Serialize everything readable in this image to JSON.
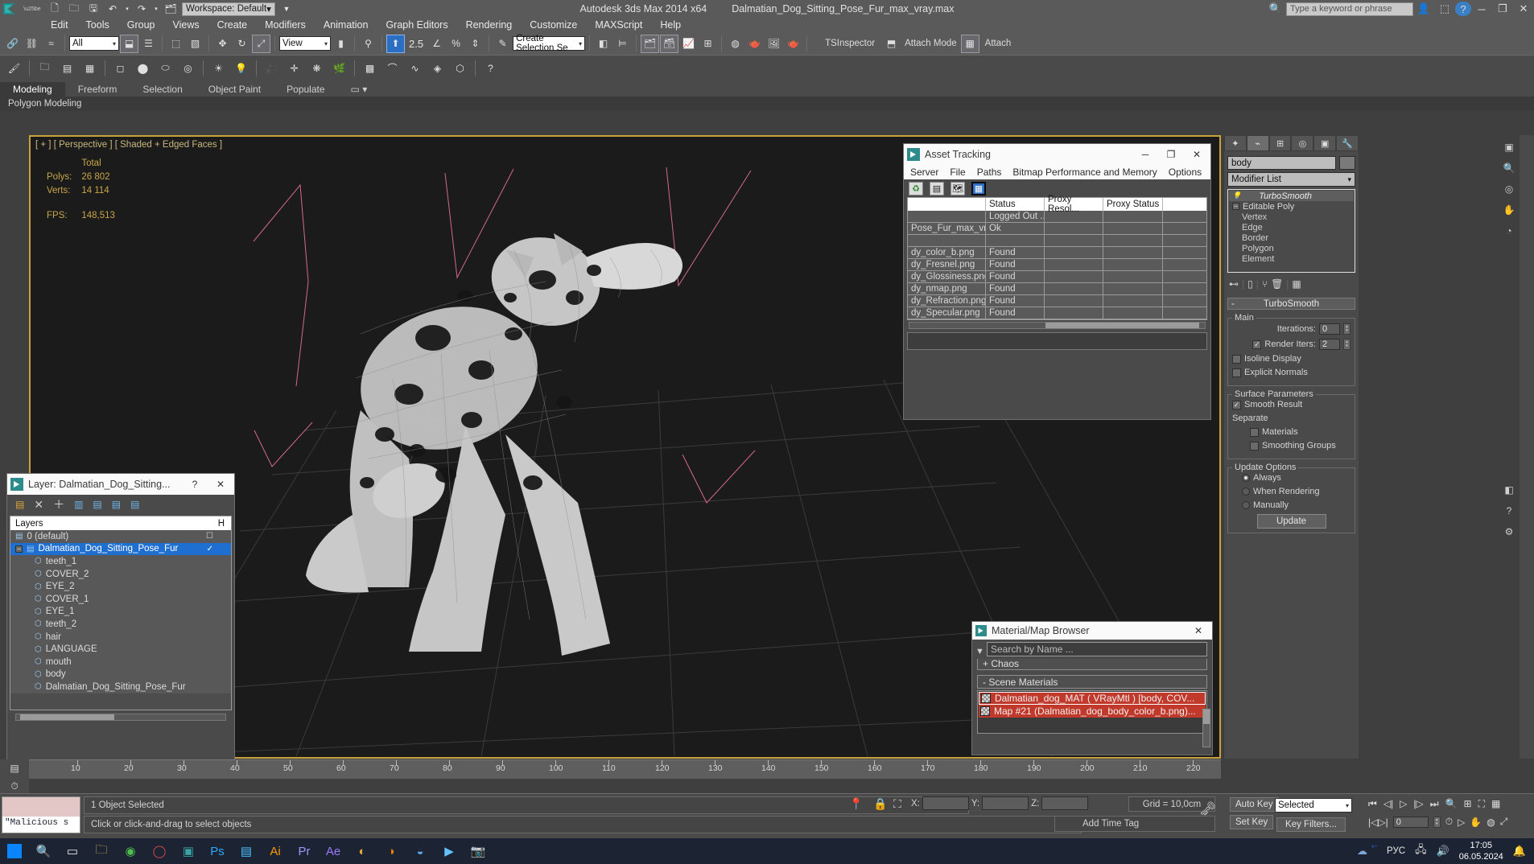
{
  "titlebar": {
    "app_title": "Autodesk 3ds Max  2014 x64",
    "file_name": "Dalmatian_Dog_Sitting_Pose_Fur_max_vray.max",
    "workspace": "Workspace: Default",
    "search_placeholder": "Type a keyword or phrase",
    "minimize": "─",
    "maximize": "❐",
    "close": "✕",
    "help": "?",
    "quick_icons": [
      "new-icon",
      "open-icon",
      "save-icon",
      "undo-icon",
      "redo-icon",
      "set-project-icon"
    ]
  },
  "menubar": {
    "items": [
      "Edit",
      "Tools",
      "Group",
      "Views",
      "Create",
      "Modifiers",
      "Animation",
      "Graph Editors",
      "Rendering",
      "Customize",
      "MAXScript",
      "Help"
    ]
  },
  "toolbar": {
    "selection_filter": "All",
    "reference_coord": "View",
    "named_selection_set": "Create Selection Se",
    "angle_snap_value": "2.5",
    "tsinspector": "TSInspector",
    "attach_mode": "Attach Mode",
    "attach": "Attach"
  },
  "ribbon": {
    "tabs": [
      "Modeling",
      "Freeform",
      "Selection",
      "Object Paint",
      "Populate"
    ],
    "active_tab": "Modeling",
    "subtab": "Polygon Modeling"
  },
  "viewport": {
    "label": "[ + ] [ Perspective ] [ Shaded + Edged Faces ]",
    "stats_header": "Total",
    "stats": [
      {
        "name": "Polys:",
        "value": "26 802"
      },
      {
        "name": "Verts:",
        "value": "14 114"
      }
    ],
    "fps_label": "FPS:",
    "fps_value": "148,513",
    "ruler_ticks": [
      "10",
      "20",
      "30",
      "40",
      "50",
      "60",
      "70",
      "80",
      "90",
      "100",
      "110",
      "120",
      "130",
      "140",
      "150",
      "160",
      "170",
      "180",
      "190",
      "200",
      "210",
      "220"
    ]
  },
  "asset_tracking": {
    "title": "Asset Tracking",
    "menu": [
      "Server",
      "File",
      "Paths",
      "Bitmap Performance and Memory",
      "Options"
    ],
    "toolbar_icons": [
      "refresh-icon",
      "list-icon",
      "map-icon",
      "table-icon"
    ],
    "columns": [
      "",
      "Status",
      "Proxy Resol...",
      "Proxy Status"
    ],
    "rows": [
      {
        "name": "",
        "status": "Logged Out ...",
        "proxy_res": "",
        "proxy_status": ""
      },
      {
        "name": "Pose_Fur_max_vray...",
        "status": "Ok",
        "proxy_res": "",
        "proxy_status": ""
      },
      {
        "name": "",
        "status": "",
        "proxy_res": "",
        "proxy_status": ""
      },
      {
        "name": "dy_color_b.png",
        "status": "Found",
        "proxy_res": "",
        "proxy_status": ""
      },
      {
        "name": "dy_Fresnel.png",
        "status": "Found",
        "proxy_res": "",
        "proxy_status": ""
      },
      {
        "name": "dy_Glossiness.png",
        "status": "Found",
        "proxy_res": "",
        "proxy_status": ""
      },
      {
        "name": "dy_nmap.png",
        "status": "Found",
        "proxy_res": "",
        "proxy_status": ""
      },
      {
        "name": "dy_Refraction.png",
        "status": "Found",
        "proxy_res": "",
        "proxy_status": ""
      },
      {
        "name": "dy_Specular.png",
        "status": "Found",
        "proxy_res": "",
        "proxy_status": ""
      }
    ],
    "minimize": "─",
    "maximize": "❐",
    "close": "✕"
  },
  "layer_dialog": {
    "title": "Layer: Dalmatian_Dog_Sitting...",
    "help": "?",
    "close": "✕",
    "column_header": "Layers",
    "hide_col": "H",
    "rows": [
      {
        "label": "0 (default)",
        "type": "layer",
        "selected": false,
        "checked": false
      },
      {
        "label": "Dalmatian_Dog_Sitting_Pose_Fur",
        "type": "layer",
        "selected": true,
        "checked": true
      },
      {
        "label": "teeth_1",
        "type": "object",
        "selected": false,
        "checked": false
      },
      {
        "label": "COVER_2",
        "type": "object",
        "selected": false,
        "checked": false
      },
      {
        "label": "EYE_2",
        "type": "object",
        "selected": false,
        "checked": false
      },
      {
        "label": "COVER_1",
        "type": "object",
        "selected": false,
        "checked": false
      },
      {
        "label": "EYE_1",
        "type": "object",
        "selected": false,
        "checked": false
      },
      {
        "label": "teeth_2",
        "type": "object",
        "selected": false,
        "checked": false
      },
      {
        "label": "hair",
        "type": "object",
        "selected": false,
        "checked": false
      },
      {
        "label": "LANGUAGE",
        "type": "object",
        "selected": false,
        "checked": false
      },
      {
        "label": "mouth",
        "type": "object",
        "selected": false,
        "checked": false
      },
      {
        "label": "body",
        "type": "object",
        "selected": false,
        "checked": false
      },
      {
        "label": "Dalmatian_Dog_Sitting_Pose_Fur",
        "type": "object",
        "selected": false,
        "checked": false
      }
    ]
  },
  "material_browser": {
    "title": "Material/Map Browser",
    "close": "✕",
    "search_placeholder": "Search by Name ...",
    "group_chaos": "+ Chaos",
    "group_scene": "-  Scene Materials",
    "items": [
      {
        "label": "Dalmatian_dog_MAT  ( VRayMtl )  [body, COV...",
        "highlight": "outline"
      },
      {
        "label": "Map #21 (Dalmatian_dog_body_color_b.png)...",
        "highlight": "red"
      }
    ]
  },
  "command_panel": {
    "object_name": "body",
    "modifier_list": "Modifier List",
    "stack": [
      "TurboSmooth",
      "Editable Poly",
      "Vertex",
      "Edge",
      "Border",
      "Polygon",
      "Element"
    ],
    "rollup_title": "TurboSmooth",
    "rollup_minus": "-",
    "groups": {
      "main": {
        "label": "Main",
        "iterations_label": "Iterations:",
        "iterations_value": "0",
        "render_iters_label": "Render Iters:",
        "render_iters_value": "2",
        "render_iters_checked": true,
        "isoline_label": "Isoline Display",
        "isoline_checked": false,
        "explicit_label": "Explicit Normals",
        "explicit_checked": false
      },
      "surface": {
        "label": "Surface Parameters",
        "smooth_result_label": "Smooth Result",
        "smooth_result_checked": true,
        "separate_label": "Separate",
        "materials_label": "Materials",
        "materials_checked": false,
        "smoothing_groups_label": "Smoothing Groups",
        "smoothing_groups_checked": false
      },
      "update": {
        "label": "Update Options",
        "options": [
          "Always",
          "When Rendering",
          "Manually"
        ],
        "selected": "Always",
        "update_button": "Update"
      }
    }
  },
  "statusbar": {
    "selection_status": "1 Object Selected",
    "prompt": "Click or click-and-drag to select objects",
    "listener_text": "\"Malicious s",
    "x_label": "X:",
    "y_label": "Y:",
    "z_label": "Z:",
    "x_value": "",
    "y_value": "",
    "z_value": "",
    "grid": "Grid = 10,0cm",
    "add_time_tag": "Add Time Tag",
    "auto_key": "Auto Key",
    "set_key": "Set Key",
    "key_mode": "Selected",
    "key_filters": "Key Filters...",
    "frame_value": "0"
  },
  "taskbar": {
    "apps": [
      "start-icon",
      "search-icon",
      "folder-icon",
      "chrome-icon",
      "opera-icon",
      "max-icon",
      "photoshop-icon",
      "illustrator-icon",
      "premiere-icon",
      "aftereffects-icon",
      "substance-icon",
      "blender-icon",
      "edge-icon",
      "media-icon",
      "camera-icon"
    ],
    "tray_lang": "РУС",
    "tray_icons": [
      "onedrive-icon",
      "bluetooth-icon",
      "network-icon",
      "volume-icon",
      "notification-icon"
    ],
    "clock_time": "17:05",
    "clock_date": "06.05.2024"
  },
  "colors": {
    "accent_blue": "#2b6fc6",
    "viewport_border": "#c8a13a",
    "stat_text": "#c8a548",
    "panel_bg": "#4a4a4a",
    "highlight_red": "#c0392b"
  }
}
